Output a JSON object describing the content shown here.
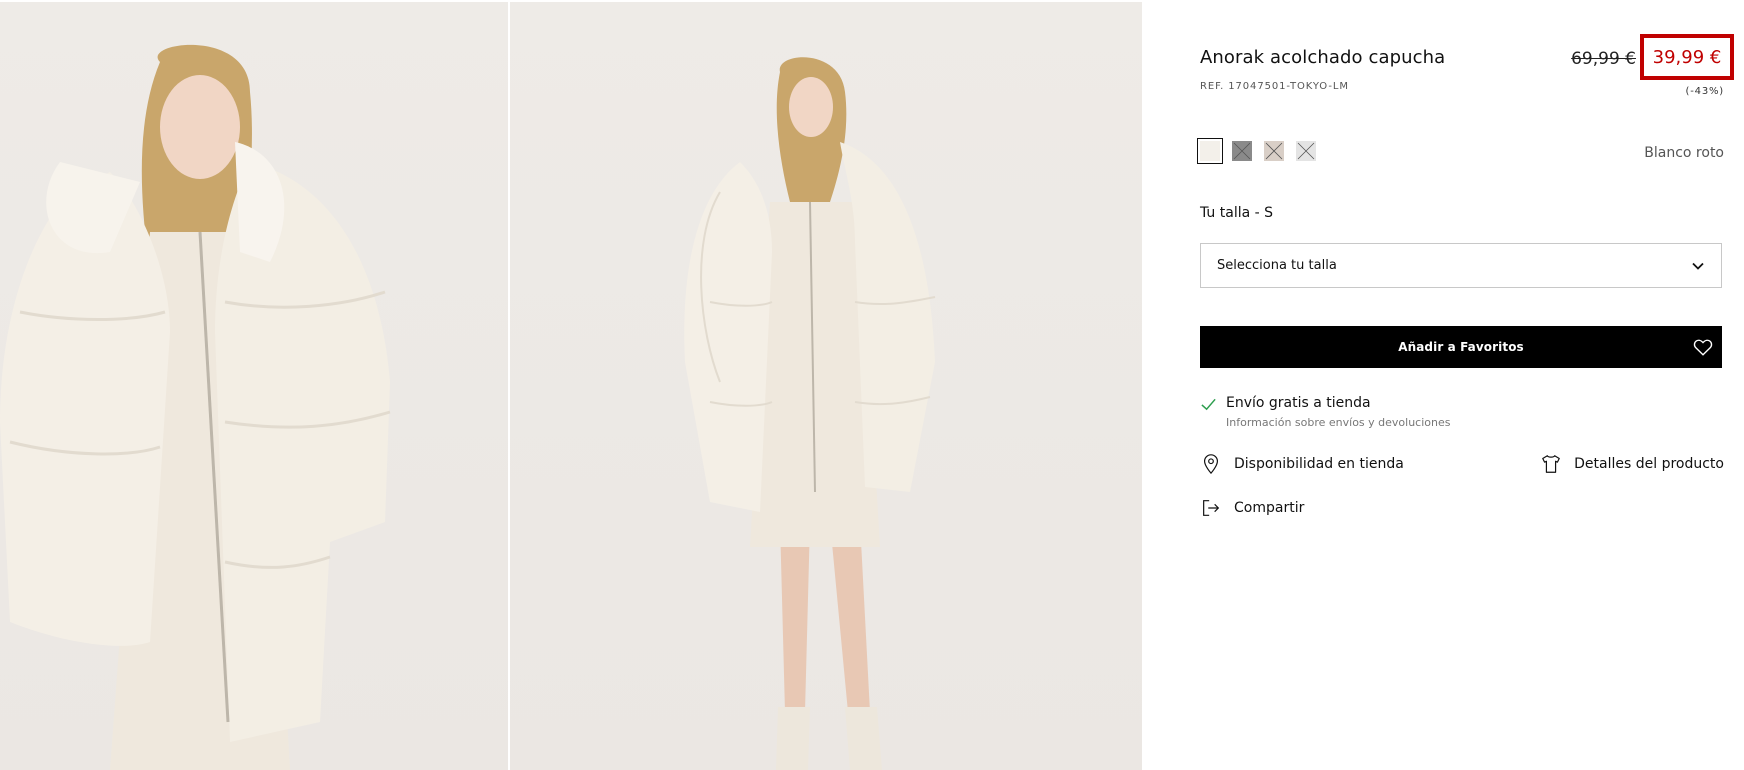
{
  "product": {
    "title": "Anorak acolchado capucha",
    "ref": "REF. 17047501-TOKYO-LM",
    "old_price": "69,99 €",
    "new_price": "39,99 €",
    "discount": "(-43%)",
    "color_name": "Blanco roto",
    "size_label": "Tu talla - S",
    "size_select_placeholder": "Selecciona tu talla",
    "favorites_button": "Añadir a Favoritos",
    "shipping_title": "Envío gratis a tienda",
    "shipping_sub": "Información sobre envíos y devoluciones",
    "availability_link": "Disponibilidad en tienda",
    "details_link": "Detalles del producto",
    "share_link": "Compartir"
  },
  "swatches": [
    {
      "name": "off-white",
      "color": "#f3f0ea",
      "available": true,
      "selected": true
    },
    {
      "name": "grey",
      "color": "#8a8a8a",
      "available": false,
      "selected": false
    },
    {
      "name": "beige",
      "color": "#d9cfc7",
      "available": false,
      "selected": false
    },
    {
      "name": "light-grey",
      "color": "#e4e4e4",
      "available": false,
      "selected": false
    }
  ],
  "colors": {
    "sale_red": "#c00000",
    "button_black": "#000000",
    "check_green": "#2e9e4f"
  }
}
